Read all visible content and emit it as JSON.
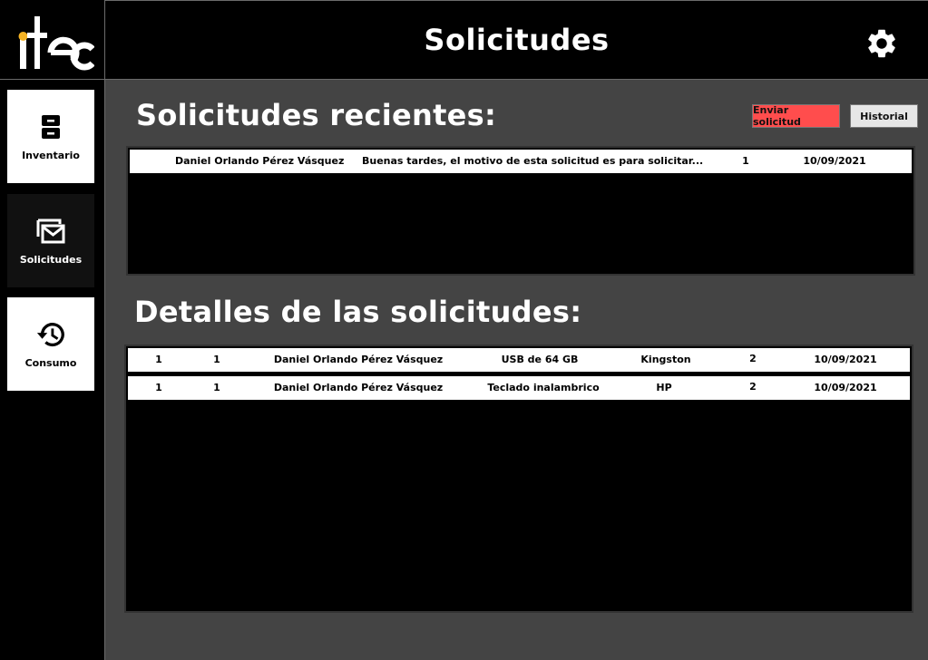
{
  "app": {
    "logo_text": "itec",
    "header_title": "Solicitudes"
  },
  "sidebar": {
    "items": [
      {
        "label": "Inventario",
        "icon": "cabinet-icon"
      },
      {
        "label": "Solicitudes",
        "icon": "mail-icon"
      },
      {
        "label": "Consumo",
        "icon": "history-icon"
      }
    ]
  },
  "recent": {
    "title": "Solicitudes recientes:",
    "send_label": "Enviar solicitud",
    "history_label": "Historial",
    "rows": [
      {
        "name": "Daniel Orlando Pérez Vásquez",
        "message": "Buenas tardes, el motivo de esta solicitud es para solicitar...",
        "qty": "1",
        "date": "10/09/2021"
      }
    ]
  },
  "details": {
    "title": "Detalles de las solicitudes:",
    "rows": [
      {
        "col1": "1",
        "col2": "1",
        "name": "Daniel Orlando Pérez Vásquez",
        "product": "USB de 64 GB",
        "brand": "Kingston",
        "qty": "2",
        "date": "10/09/2021"
      },
      {
        "col1": "1",
        "col2": "1",
        "name": "Daniel Orlando Pérez Vásquez",
        "product": "Teclado inalambrico",
        "brand": "HP",
        "qty": "2",
        "date": "10/09/2021"
      }
    ]
  },
  "colors": {
    "accent_red": "#ff4d4d",
    "logo_dot": "#f5b324",
    "background": "#444444"
  }
}
